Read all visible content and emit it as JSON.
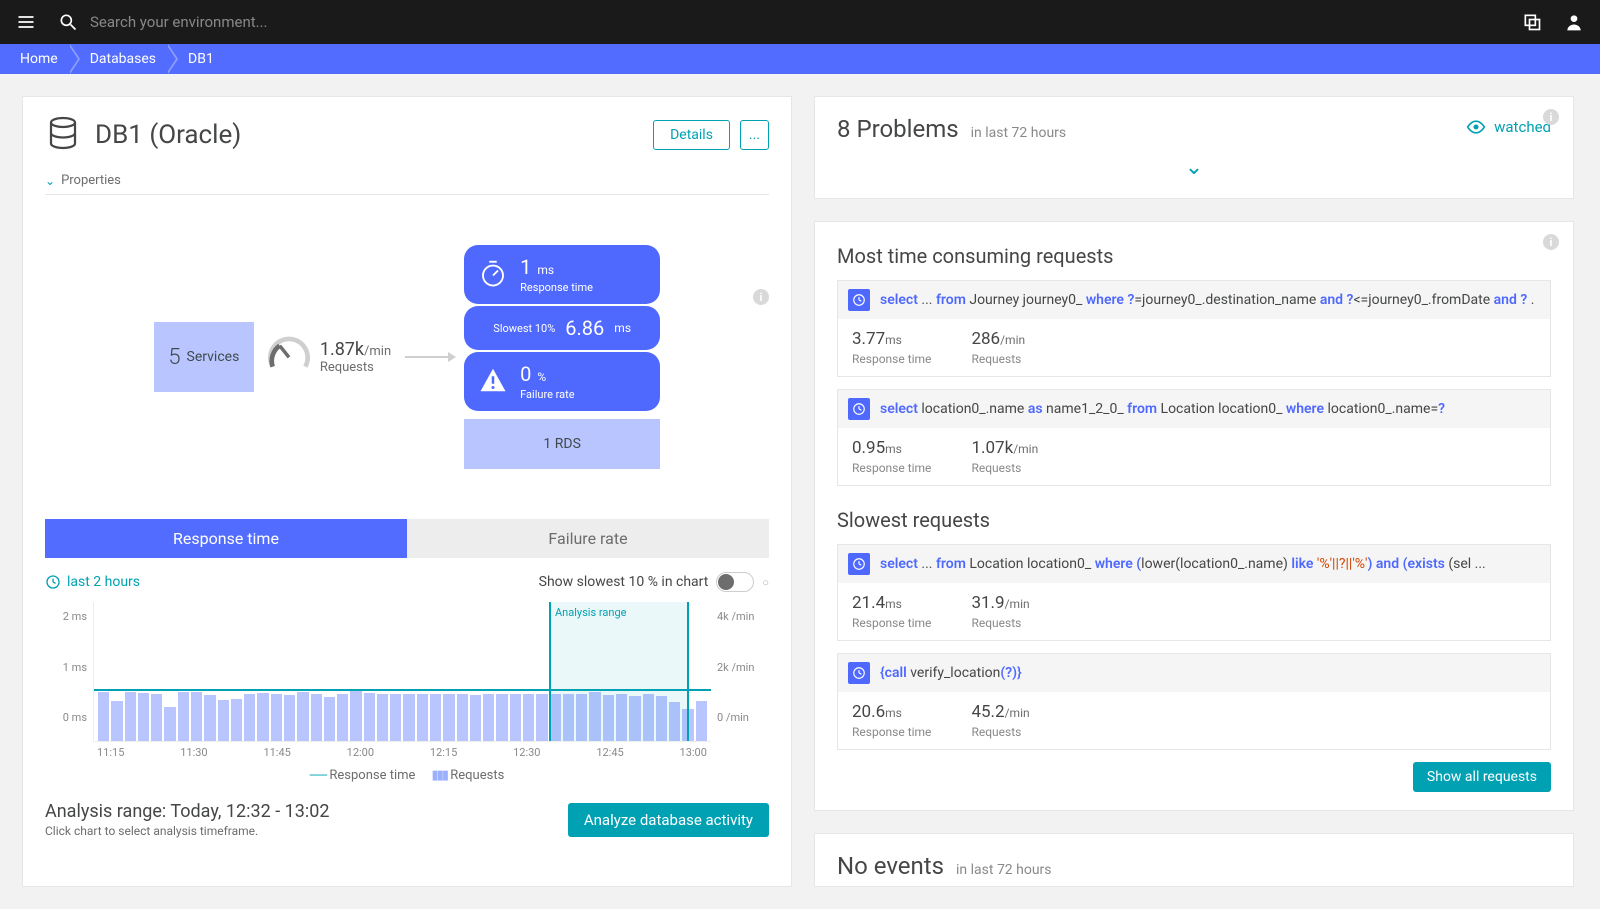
{
  "search_placeholder": "Search your environment...",
  "breadcrumb": [
    "Home",
    "Databases",
    "DB1"
  ],
  "db_title": "DB1 (Oracle)",
  "details_btn": "Details",
  "more_btn": "...",
  "properties_label": "Properties",
  "topology": {
    "services_count": "5",
    "services_label": "Services",
    "requests_val": "1.87k",
    "requests_unit": "/min",
    "requests_label": "Requests",
    "resp_val": "1",
    "resp_unit": "ms",
    "resp_label": "Response time",
    "slowest_prefix": "Slowest 10%",
    "slowest_val": "6.86",
    "slowest_unit": "ms",
    "fail_val": "0",
    "fail_unit": "%",
    "fail_label": "Failure rate",
    "rds_label": "1 RDS"
  },
  "tabs": {
    "response": "Response time",
    "failure": "Failure rate"
  },
  "last_hours": "last 2 hours",
  "slowest_toggle_label": "Show slowest 10 % in chart",
  "chart_data": {
    "type": "bar",
    "title": "",
    "x_ticks": [
      "11:15",
      "11:30",
      "11:45",
      "12:00",
      "12:15",
      "12:30",
      "12:45",
      "13:00"
    ],
    "y_left_ticks": [
      "2 ms",
      "1 ms",
      "0 ms"
    ],
    "y_right_ticks": [
      "4k /min",
      "2k /min",
      "0 /min"
    ],
    "ylim_left_ms": [
      0,
      2
    ],
    "ylim_right_per_min": [
      0,
      4000
    ],
    "analysis_range_label": "Analysis range",
    "legend": [
      "Response time",
      "Requests"
    ],
    "series": [
      {
        "name": "Requests",
        "kind": "bar",
        "unit": "/min",
        "values": [
          1980,
          1600,
          1960,
          1930,
          1900,
          1370,
          1970,
          1950,
          1850,
          1650,
          1700,
          1900,
          1940,
          1870,
          1830,
          1980,
          1880,
          1780,
          1870,
          1990,
          1940,
          1900,
          1880,
          1890,
          1900,
          1880,
          1870,
          1890,
          1860,
          1900,
          1900,
          1870,
          1900,
          1880,
          1870,
          1880,
          1900,
          1950,
          1860,
          1900,
          1800,
          1900,
          1800,
          1550,
          1270,
          1600
        ]
      },
      {
        "name": "Response time",
        "kind": "line",
        "unit": "ms",
        "values": [
          1,
          1,
          1,
          1,
          1,
          1,
          1,
          1,
          1,
          1,
          1,
          1,
          1,
          1,
          1,
          1,
          1,
          1,
          1,
          1,
          1,
          1,
          1,
          1,
          1,
          1,
          1,
          1,
          1,
          1,
          1,
          1,
          1,
          1,
          1,
          1,
          1,
          1,
          1,
          1,
          1,
          1,
          1,
          1,
          1,
          1
        ]
      }
    ]
  },
  "analysis_range_text": "Analysis range: Today, 12:32 - 13:02",
  "analysis_hint": "Click chart to select analysis timeframe.",
  "analyze_btn": "Analyze database activity",
  "problems": {
    "count": "8 Problems",
    "sub": "in last 72 hours",
    "watched": "watched"
  },
  "requests": {
    "most_title": "Most time consuming requests",
    "slowest_title": "Slowest requests",
    "show_all": "Show all requests",
    "rt_label": "Response time",
    "rq_label": "Requests",
    "most": [
      {
        "sql_html": "<span class='kw'>select</span> <span class='txt'>...</span> <span class='kw'>from</span> <span class='txt'>Journey journey0_</span> <span class='kw'>where</span> <span class='kw'>?</span><span class='txt'>=journey0_.destination_name</span> <span class='kw'>and</span> <span class='kw'>?</span><span class='txt'>&lt;=journey0_.fromDate</span> <span class='kw'>and</span> <span class='kw'>?</span> <span class='txt'>.</span>",
        "rt_val": "3.77",
        "rt_unit": "ms",
        "rq_val": "286",
        "rq_unit": "/min"
      },
      {
        "sql_html": "<span class='kw'>select</span> <span class='txt'>location0_.name</span> <span class='kw'>as</span> <span class='txt'>name1_2_0_</span> <span class='kw'>from</span> <span class='txt'>Location location0_</span> <span class='kw'>where</span> <span class='txt'>location0_.name=</span><span class='kw'>?</span>",
        "rt_val": "0.95",
        "rt_unit": "ms",
        "rq_val": "1.07k",
        "rq_unit": "/min"
      }
    ],
    "slowest": [
      {
        "sql_html": "<span class='kw'>select</span> <span class='txt'>...</span> <span class='kw'>from</span> <span class='txt'>Location location0_</span> <span class='kw'>where</span> <span class='kw'>(</span><span class='txt'>lower(location0_.name)</span> <span class='kw'>like</span> <span class='str'>'%'||?||'%'</span><span class='kw'>)</span> <span class='kw'>and</span> <span class='kw'>(</span><span class='kw'>exists</span> <span class='txt'>(sel ...</span>",
        "rt_val": "21.4",
        "rt_unit": "ms",
        "rq_val": "31.9",
        "rq_unit": "/min"
      },
      {
        "sql_html": "<span class='kw'>{</span><span class='kw'>call</span> <span class='txt'>verify_location</span><span class='kw'>(</span><span class='kw'>?</span><span class='kw'>)</span><span class='kw'>}</span>",
        "rt_val": "20.6",
        "rt_unit": "ms",
        "rq_val": "45.2",
        "rq_unit": "/min"
      }
    ]
  },
  "events": {
    "title": "No events",
    "sub": "in last 72 hours"
  }
}
